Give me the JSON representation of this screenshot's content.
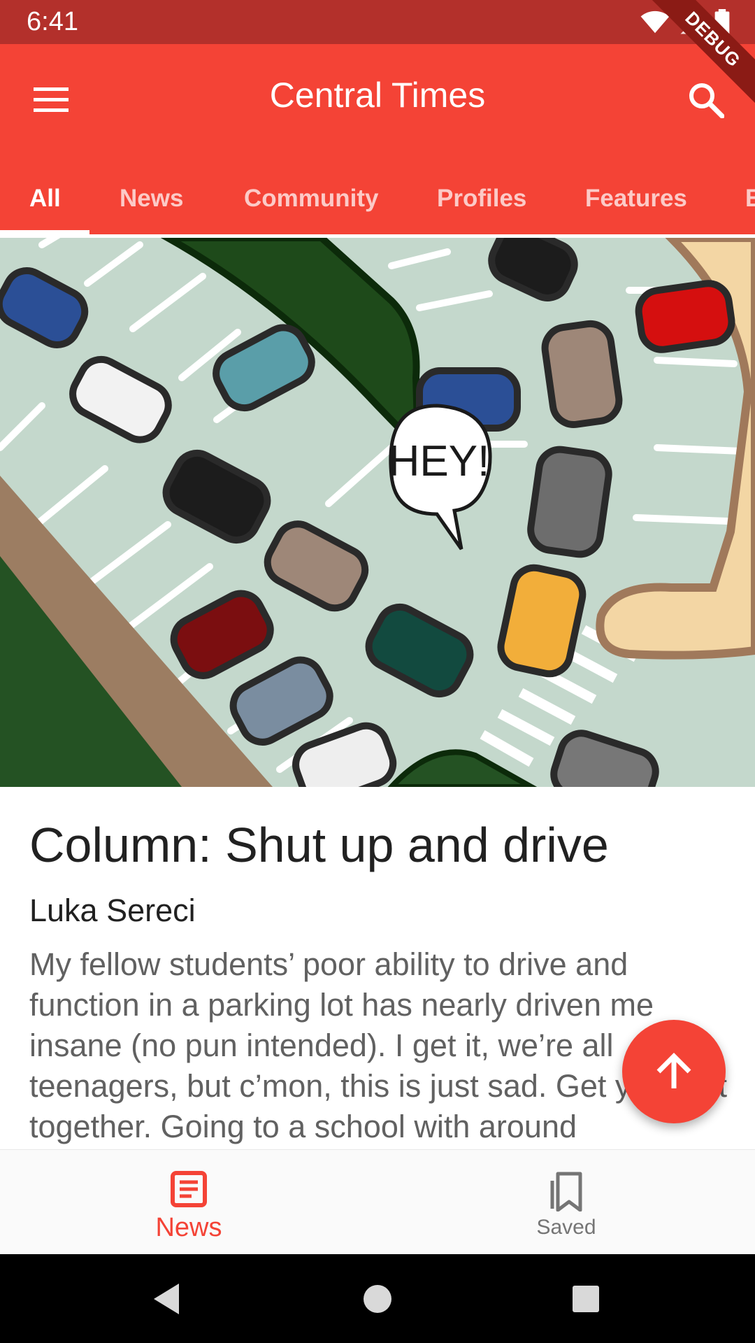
{
  "status_bar": {
    "time": "6:41",
    "debug_label": "DEBUG"
  },
  "app_bar": {
    "title": "Central Times"
  },
  "tabs": [
    {
      "label": "All",
      "active": true
    },
    {
      "label": "News"
    },
    {
      "label": "Community"
    },
    {
      "label": "Profiles"
    },
    {
      "label": "Features"
    },
    {
      "label": "E"
    }
  ],
  "hero": {
    "speech_bubble_text": "HEY!"
  },
  "article": {
    "title": "Column: Shut up and drive",
    "author": "Luka Sereci",
    "excerpt": "My fellow students’ poor ability to drive and function in a parking lot has nearly driven me insane (no pun intended). I get it, we’re all teenagers, but c’mon, this is just sad. Get your act together.  Going to a school with around"
  },
  "bottom_nav": {
    "items": [
      {
        "label": "News",
        "icon": "article-icon",
        "active": true
      },
      {
        "label": "Saved",
        "icon": "bookmarks-icon",
        "active": false
      }
    ]
  },
  "colors": {
    "primary": "#f44336",
    "status_bar": "#b3302b",
    "inactive": "#757575"
  }
}
